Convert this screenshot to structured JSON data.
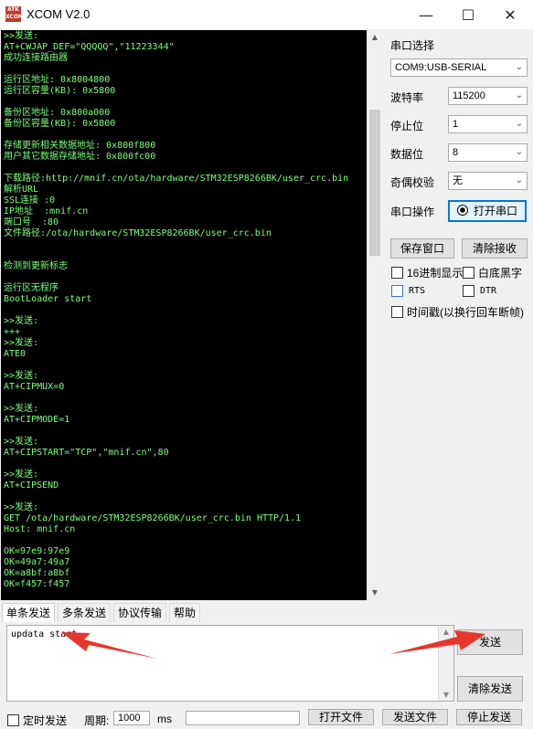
{
  "window": {
    "logo_text": "ATK XCOM",
    "title": "XCOM V2.0",
    "minimize_glyph": "—",
    "maximize_glyph": "☐",
    "close_glyph": "✕"
  },
  "terminal": {
    "lines": [
      ">>发送:",
      "AT+CWJAP_DEF=\"QQQQQ\",\"11223344\"",
      "成功连接路由器",
      "",
      "运行区地址: 0x8004800",
      "运行区容量(KB): 0x5800",
      "",
      "备份区地址: 0x800a000",
      "备份区容量(KB): 0x5800",
      "",
      "存储更新相关数据地址: 0x800f800",
      "用户其它数据存储地址: 0x800fc00",
      "",
      "下载路径:http://mnif.cn/ota/hardware/STM32ESP8266BK/user_crc.bin",
      "解析URL",
      "SSL连接 :0",
      "IP地址  :mnif.cn",
      "端口号  :80",
      "文件路径:/ota/hardware/STM32ESP8266BK/user_crc.bin",
      "",
      "",
      "检测到更新标志",
      "",
      "运行区无程序",
      "BootLoader start",
      "",
      ">>发送:",
      "+++",
      ">>发送:",
      "ATE0",
      "",
      ">>发送:",
      "AT+CIPMUX=0",
      "",
      ">>发送:",
      "AT+CIPMODE=1",
      "",
      ">>发送:",
      "AT+CIPSTART=\"TCP\",\"mnif.cn\",80",
      "",
      ">>发送:",
      "AT+CIPSEND",
      "",
      ">>发送:",
      "GET /ota/hardware/STM32ESP8266BK/user_crc.bin HTTP/1.1",
      "Host: mnif.cn",
      "",
      "OK=97e9:97e9",
      "OK=49a7:49a7",
      "OK=a8bf:a8bf",
      "OK=f457:f457"
    ]
  },
  "panel": {
    "port_select_label": "串口选择",
    "port_value": "COM9:USB-SERIAL",
    "baud_label": "波特率",
    "baud_value": "115200",
    "stopbit_label": "停止位",
    "stopbit_value": "1",
    "databit_label": "数据位",
    "databit_value": "8",
    "parity_label": "奇偶校验",
    "parity_value": "无",
    "port_op_label": "串口操作",
    "open_port_button": "打开串口",
    "save_window_button": "保存窗口",
    "clear_receive_button": "清除接收",
    "hex_display_label": "16进制显示",
    "white_bg_label": "白底黑字",
    "rts_label": "RTS",
    "dtr_label": "DTR",
    "timestamp_label": "时间戳(以换行回车断帧)"
  },
  "tabs": [
    "单条发送",
    "多条发送",
    "协议传输",
    "帮助"
  ],
  "send": {
    "text": "updata start",
    "send_button": "发送",
    "clear_send_button": "清除发送"
  },
  "bottom": {
    "timed_send_label": "定时发送",
    "period_label": "周期:",
    "period_value": "1000",
    "period_unit": "ms",
    "open_file_button": "打开文件",
    "send_file_button": "发送文件",
    "stop_send_button": "停止发送"
  },
  "colors": {
    "terminal_bg": "#000000",
    "terminal_text": "#7cff7c",
    "annotation_arrow": "#e8352b",
    "focus_blue": "#0078d7"
  }
}
